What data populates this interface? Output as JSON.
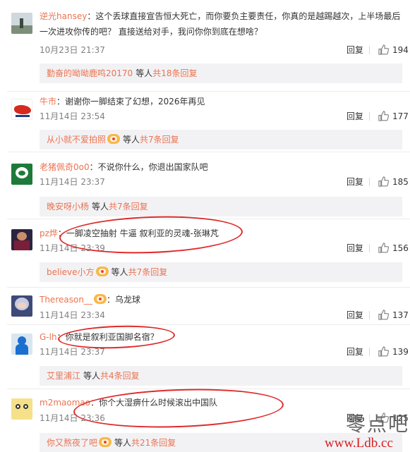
{
  "comments": [
    {
      "username": "逆光hansey",
      "text": "：这个丢球直接宣告恒大死亡，而你要负主要责任，你真的是越踢越次，上半场最后一次进攻你传的吧？ 直接送给对手，我问你你到底在想啥？",
      "time": "10月23日 21:37",
      "reply": "回复",
      "likes": "194",
      "sub": {
        "user": "勤奋的呦呦鹿鸣20170",
        "info": "等人",
        "count": "共18条回复"
      },
      "avatar_icon": "landscape-avatar-icon"
    },
    {
      "username": "牛市",
      "text": "：谢谢你一脚结束了幻想，2026年再见",
      "time": "11月14日 23:54",
      "reply": "回复",
      "likes": "177",
      "sub": {
        "user": "从小就不爱拍照",
        "info": "等人",
        "count": "共7条回复"
      },
      "avatar_icon": "red-bull-avatar-icon"
    },
    {
      "username": "老猪佩奇0o0",
      "text": "：不说你什么，你退出国家队吧",
      "time": "11月14日 23:37",
      "reply": "回复",
      "likes": "185",
      "sub": {
        "user": "晚安呀小杨",
        "info": "等人",
        "count": "共7条回复"
      },
      "avatar_icon": "green-logo-avatar-icon"
    },
    {
      "username": "pz烨",
      "text": "：一脚凌空抽射 牛逼 叙利亚的灵魂-张琳芃",
      "time": "11月14日 23:39",
      "reply": "回复",
      "likes": "156",
      "sub": {
        "user": "believe小方",
        "info": "等人",
        "count": "共7条回复"
      },
      "avatar_icon": "footballer-avatar-icon"
    },
    {
      "username": "Thereason__",
      "text": "：乌龙球",
      "time": "11月14日 23:34",
      "reply": "回复",
      "likes": "137",
      "avatar_icon": "anime-avatar-icon"
    },
    {
      "username": "G-lh",
      "text": "：你就是叙利亚国脚名宿？",
      "time": "11月14日 23:37",
      "reply": "回复",
      "likes": "139",
      "sub": {
        "user": "艾里浦江",
        "info": "等人",
        "count": "共4条回复"
      },
      "avatar_icon": "blue-figure-avatar-icon"
    },
    {
      "username": "m2maomao",
      "text": "：你个大湿痹什么时候滚出中国队",
      "time": "11月14日 23:36",
      "reply": "回复",
      "likes": "125",
      "sub": {
        "user": "你又熬夜了吧",
        "info": "等人",
        "count": "共21条回复"
      },
      "avatar_icon": "cartoon-face-avatar-icon"
    }
  ],
  "watermark": {
    "cn": "零点吧",
    "url": "www.Ldb.cc"
  },
  "colors": {
    "username": "#eb7350",
    "annotation_red": "#e02a2a",
    "sub_bg": "#f2f2f5"
  }
}
